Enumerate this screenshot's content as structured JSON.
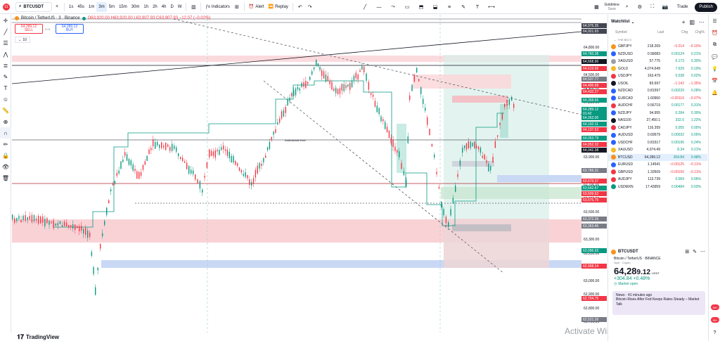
{
  "topbar": {
    "avatar_text": "11",
    "symbol": "BTCUSDT",
    "add_symbol": "+",
    "timeframes": [
      "1s",
      "45s",
      "1m",
      "3m",
      "5m",
      "15m",
      "30m",
      "1h",
      "2h",
      "4h",
      "D",
      "W"
    ],
    "active_timeframe": "3m",
    "indicators_label": "Indicators",
    "alert_label": "Alert",
    "replay_label": "Replay",
    "layout_name": "Goldmine",
    "layout_sub": "Save",
    "trade_label": "Trade",
    "publish_label": "Publish"
  },
  "legend": {
    "title": "Bitcoin / TetherUS · 3 · Binance",
    "ohlc": "O63,920.00 H63,920.00 L63,907.93 C63,907.93 −12.07 (−0.02%)",
    "sell_price": "64,289.12",
    "sell_label": "SELL",
    "spread": "0.01",
    "buy_price": "64,289.13",
    "buy_label": "BUY",
    "qty": "10"
  },
  "chart_annotations": {
    "institutional_level": "Institutional level"
  },
  "price_axis": {
    "ticks": [
      "64,800.00",
      "64,600.00",
      "64,500.00",
      "64,400.00",
      "64,300.00",
      "64,200.00",
      "64,100.00",
      "64,000.00",
      "63,900.00",
      "63,800.00",
      "63,700.00",
      "63,600.00",
      "63,500.00",
      "63,400.00",
      "63,300.00",
      "63,200.00",
      "63,100.00",
      "63,000.00",
      "62,900.00",
      "62,800.00",
      "62,700.00",
      "62,600.00",
      "62,500.00"
    ],
    "labels": [
      {
        "text": "64,975.35",
        "color": "#434651"
      },
      {
        "text": "64,921.93",
        "color": "#434651"
      },
      {
        "text": "64,760.38",
        "color": "#089981"
      },
      {
        "text": "64,668.90",
        "color": "#131722"
      },
      {
        "text": "64,619.96",
        "color": "#f23645"
      },
      {
        "text": "64,537.77",
        "color": "#787b86"
      },
      {
        "text": "64,495.68",
        "color": "#f23645"
      },
      {
        "text": "64,432.27",
        "color": "#f23645"
      },
      {
        "text": "64,358.66",
        "color": "#089981"
      },
      {
        "text": "64,289.12",
        "color": "#089981"
      },
      {
        "text": "01:42",
        "color": "#089981"
      },
      {
        "text": "64,262.00",
        "color": "#089981"
      },
      {
        "text": "64,192.11",
        "color": "#089981"
      },
      {
        "text": "64,137.52",
        "color": "#f23645"
      },
      {
        "text": "64,053.79",
        "color": "#089981"
      },
      {
        "text": "64,052.32",
        "color": "#f23645"
      },
      {
        "text": "64,042.38",
        "color": "#131722"
      },
      {
        "text": "63,766.31",
        "color": "#787b86"
      },
      {
        "text": "63,679.37",
        "color": "#f23645"
      },
      {
        "text": "63,642.67",
        "color": "#089981"
      },
      {
        "text": "63,609.62",
        "color": "#f23645"
      },
      {
        "text": "63,575.75",
        "color": "#f23645"
      },
      {
        "text": "63,372.39",
        "color": "#787b86"
      },
      {
        "text": "63,353.45",
        "color": "#787b86"
      },
      {
        "text": "63,096.93",
        "color": "#089981"
      },
      {
        "text": "62,968.24",
        "color": "#f23645"
      },
      {
        "text": "62,704.75",
        "color": "#f23645"
      },
      {
        "text": "62,521.26",
        "color": "#787b86"
      }
    ]
  },
  "bottom": {
    "logo_text": "TradingView",
    "watermark_line1": "Activate Windows",
    "watermark_line2": "Go to Settings to activate Windows."
  },
  "watchlist": {
    "title": "Watchlist",
    "columns": {
      "symbol": "Symbol",
      "last": "Last",
      "chg": "Chg",
      "chgp": "Chg%"
    },
    "group": "THE BIG 5",
    "rows": [
      {
        "symbol": "GBPJPY",
        "last": "218.269",
        "chg": "−0.214",
        "chgp": "−0.10%",
        "dir": "down",
        "color": "#f7931a"
      },
      {
        "symbol": "NZDUSD",
        "last": "0.58083",
        "chg": "0.00124",
        "chgp": "0.21%",
        "dir": "up",
        "color": "#2962ff"
      },
      {
        "symbol": "XAGUSD",
        "last": "57.775",
        "chg": "0.173",
        "chgp": "0.30%",
        "dir": "up",
        "color": "#9aa0a6"
      },
      {
        "symbol": "GOLD",
        "last": "4,074.649",
        "chg": "7.629",
        "chgp": "0.19%",
        "dir": "up",
        "color": "#f7b924"
      },
      {
        "symbol": "USDJPY",
        "last": "163.479",
        "chg": "0.038",
        "chgp": "0.02%",
        "dir": "up",
        "color": "#f23645"
      },
      {
        "symbol": "USOIL",
        "last": "83.697",
        "chg": "−1.142",
        "chgp": "−1.35%",
        "dir": "down",
        "color": "#131722"
      },
      {
        "symbol": "NZDCAD",
        "last": "0.81597",
        "chg": "0.00229",
        "chgp": "0.28%",
        "dir": "up",
        "color": "#2962ff"
      },
      {
        "symbol": "EURCAD",
        "last": "1.60960",
        "chg": "−0.00116",
        "chgp": "−0.07%",
        "dir": "down",
        "color": "#2962ff"
      },
      {
        "symbol": "AUDCHF",
        "last": "0.56719",
        "chg": "0.00177",
        "chgp": "0.31%",
        "dir": "up",
        "color": "#f23645"
      },
      {
        "symbol": "NZDJPY",
        "last": "94.955",
        "chg": "0.284",
        "chgp": "0.30%",
        "dir": "up",
        "color": "#2962ff"
      },
      {
        "symbol": "NAS100",
        "last": "27,450.1",
        "chg": "332.0",
        "chgp": "1.22%",
        "dir": "up",
        "color": "#131722"
      },
      {
        "symbol": "CADJPY",
        "last": "116.359",
        "chg": "0.055",
        "chgp": "0.05%",
        "dir": "up",
        "color": "#f23645"
      },
      {
        "symbol": "AUDUSD",
        "last": "0.69579",
        "chg": "0.00032",
        "chgp": "0.05%",
        "dir": "up",
        "color": "#2962ff"
      },
      {
        "symbol": "USDCHF",
        "last": "0.81517",
        "chg": "0.00195",
        "chgp": "0.24%",
        "dir": "up",
        "color": "#2962ff"
      },
      {
        "symbol": "XAUUSD",
        "last": "4,074.49",
        "chg": "8.34",
        "chgp": "0.21%",
        "dir": "up",
        "color": "#f7b924"
      },
      {
        "symbol": "BTCUSD",
        "last": "64,289.12",
        "chg": "304.84",
        "chgp": "0.48%",
        "dir": "up",
        "color": "#f7931a"
      },
      {
        "symbol": "EURUSD",
        "last": "1.14541",
        "chg": "−0.00125",
        "chgp": "−0.11%",
        "dir": "down",
        "color": "#2962ff"
      },
      {
        "symbol": "GBPUSD",
        "last": "1.33509",
        "chg": "−0.00150",
        "chgp": "−0.11%",
        "dir": "down",
        "color": "#f23645"
      },
      {
        "symbol": "AUDJPY",
        "last": "113.739",
        "chg": "0.069",
        "chgp": "0.06%",
        "dir": "up",
        "color": "#f23645"
      },
      {
        "symbol": "USDMXN",
        "last": "17.43959",
        "chg": "0.00484",
        "chgp": "0.03%",
        "dir": "up",
        "color": "#089981"
      }
    ],
    "selected_index": 15
  },
  "detail": {
    "symbol": "BTCUSDT",
    "name": "Bitcoin / TetherUS",
    "exchange": "BINANCE",
    "type": "Spot · Crypto",
    "price_main": "64,28",
    "price_small": "9.12",
    "currency": "USDT",
    "change": "+304.84 +0.48%",
    "market_status": "Market open",
    "news_meta": "News · 41 minutes ago",
    "news_text": "Bitcoin Rises After Fed Keeps Rates Steady – Market Talk"
  },
  "rightbar": {
    "badge_top": "99+",
    "badge_bottom": "99+"
  }
}
